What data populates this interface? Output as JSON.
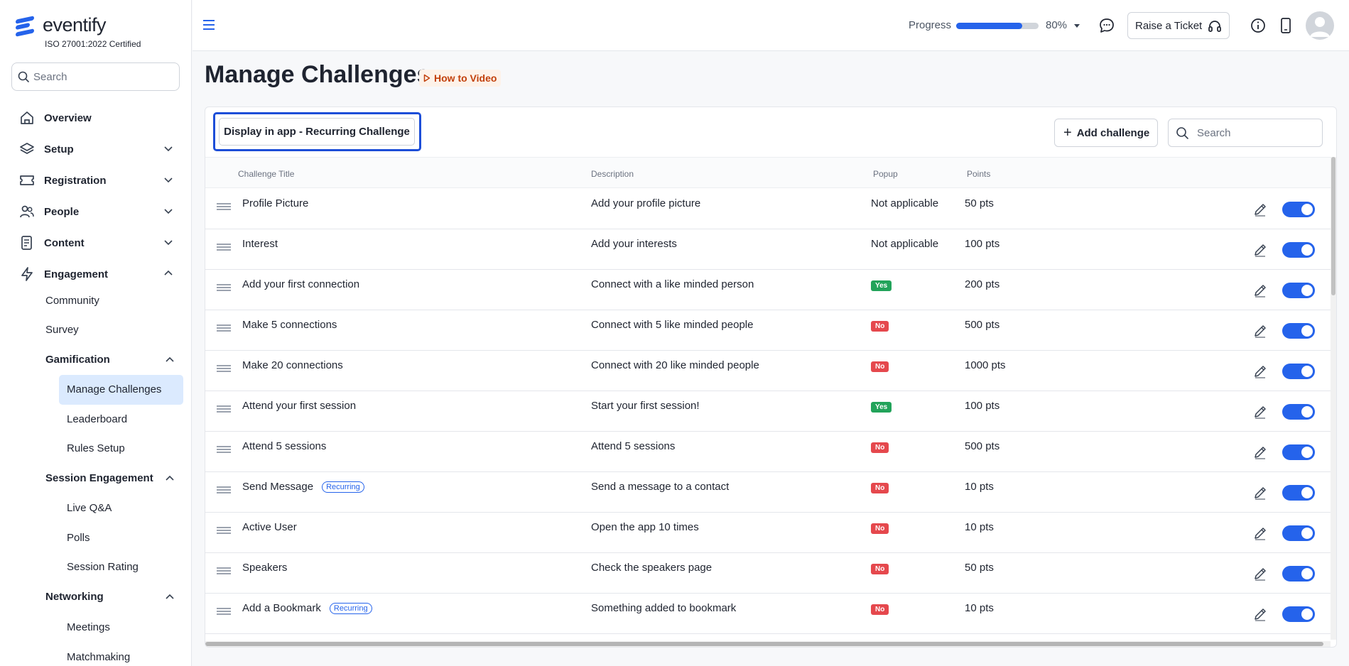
{
  "brand": {
    "name": "eventify",
    "certification": "ISO 27001:2022 Certified",
    "accent": "#2563eb"
  },
  "sidebar": {
    "search_placeholder": "Search",
    "nav": [
      {
        "label": "Overview",
        "icon": "home-icon"
      },
      {
        "label": "Setup",
        "icon": "layers-icon",
        "expanded": false
      },
      {
        "label": "Registration",
        "icon": "ticket-icon",
        "expanded": false
      },
      {
        "label": "People",
        "icon": "people-icon",
        "expanded": false
      },
      {
        "label": "Content",
        "icon": "document-icon",
        "expanded": false
      },
      {
        "label": "Engagement",
        "icon": "lightning-icon",
        "expanded": true
      }
    ],
    "engagement": {
      "community": "Community",
      "survey": "Survey",
      "gamification": {
        "label": "Gamification",
        "items": [
          "Manage Challenges",
          "Leaderboard",
          "Rules Setup"
        ],
        "active": "Manage Challenges"
      },
      "session_engagement": {
        "label": "Session Engagement",
        "items": [
          "Live Q&A",
          "Polls",
          "Session Rating"
        ]
      },
      "networking": {
        "label": "Networking",
        "items": [
          "Meetings",
          "Matchmaking"
        ]
      }
    }
  },
  "topbar": {
    "progress_label": "Progress",
    "progress_value": 0.8,
    "progress_text": "80%",
    "ticket_label": "Raise a Ticket",
    "icons": [
      "menu-icon",
      "chat-icon",
      "headset-icon",
      "info-icon",
      "mobile-icon",
      "avatar-icon"
    ]
  },
  "page": {
    "title": "Manage Challenges",
    "how_to_video": "How to Video"
  },
  "toolbar": {
    "display_button": "Display in app - Recurring Challenge",
    "add_button": "Add challenge",
    "search_placeholder": "Search"
  },
  "table": {
    "columns": [
      "Challenge Title",
      "Description",
      "Popup",
      "Points"
    ],
    "recurring_label": "Recurring",
    "rows": [
      {
        "title": "Profile Picture",
        "recurring": false,
        "description": "Add your profile picture",
        "popup": "Not applicable",
        "popup_type": "text",
        "points": "50 pts",
        "enabled": true
      },
      {
        "title": "Interest",
        "recurring": false,
        "description": "Add your interests",
        "popup": "Not applicable",
        "popup_type": "text",
        "points": "100 pts",
        "enabled": true
      },
      {
        "title": "Add your first connection",
        "recurring": false,
        "description": "Connect with a like minded person",
        "popup": "Yes",
        "popup_type": "yes",
        "points": "200 pts",
        "enabled": true
      },
      {
        "title": "Make 5 connections",
        "recurring": false,
        "description": "Connect with 5 like minded people",
        "popup": "No",
        "popup_type": "no",
        "points": "500 pts",
        "enabled": true
      },
      {
        "title": "Make 20 connections",
        "recurring": false,
        "description": "Connect with 20 like minded people",
        "popup": "No",
        "popup_type": "no",
        "points": "1000 pts",
        "enabled": true
      },
      {
        "title": "Attend your first session",
        "recurring": false,
        "description": "Start your first session!",
        "popup": "Yes",
        "popup_type": "yes",
        "points": "100 pts",
        "enabled": true
      },
      {
        "title": "Attend 5 sessions",
        "recurring": false,
        "description": "Attend 5 sessions",
        "popup": "No",
        "popup_type": "no",
        "points": "500 pts",
        "enabled": true
      },
      {
        "title": "Send Message",
        "recurring": true,
        "description": "Send a message to a contact",
        "popup": "No",
        "popup_type": "no",
        "points": "10 pts",
        "enabled": true
      },
      {
        "title": "Active User",
        "recurring": false,
        "description": "Open the app 10 times",
        "popup": "No",
        "popup_type": "no",
        "points": "10 pts",
        "enabled": true
      },
      {
        "title": "Speakers",
        "recurring": false,
        "description": "Check the speakers page",
        "popup": "No",
        "popup_type": "no",
        "points": "50 pts",
        "enabled": true
      },
      {
        "title": "Add a Bookmark",
        "recurring": true,
        "description": "Something added to bookmark",
        "popup": "No",
        "popup_type": "no",
        "points": "10 pts",
        "enabled": true
      }
    ]
  }
}
